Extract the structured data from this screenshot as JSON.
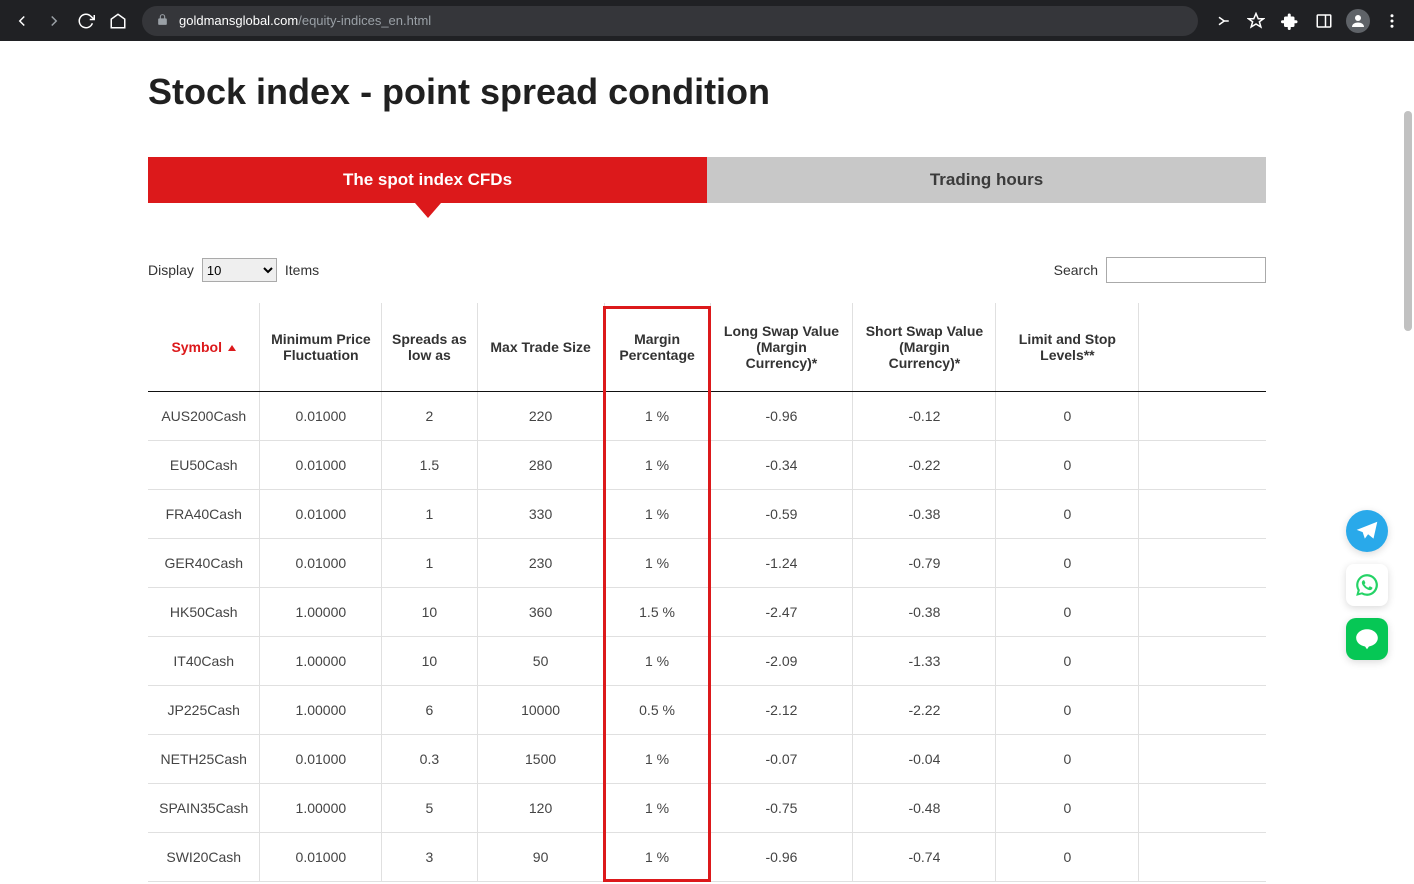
{
  "browser": {
    "url_domain": "goldmansglobal.com",
    "url_path": "/equity-indices_en.html"
  },
  "page": {
    "title": "Stock index - point spread condition"
  },
  "tabs": {
    "active": "The spot index CFDs",
    "inactive": "Trading hours"
  },
  "controls": {
    "display_label": "Display",
    "display_value": "10",
    "items_label": "Items",
    "search_label": "Search",
    "search_value": ""
  },
  "table": {
    "headers": [
      "Symbol",
      "Minimum Price Fluctuation",
      "Spreads as low as",
      "Max Trade Size",
      "Margin Percentage",
      "Long Swap Value (Margin Currency)*",
      "Short Swap Value (Margin Currency)*",
      "Limit and Stop Levels**"
    ],
    "rows": [
      {
        "symbol": "AUS200Cash",
        "min_price": "0.01000",
        "spreads": "2",
        "max_trade": "220",
        "margin": "1 %",
        "long_swap": "-0.96",
        "short_swap": "-0.12",
        "limit_stop": "0"
      },
      {
        "symbol": "EU50Cash",
        "min_price": "0.01000",
        "spreads": "1.5",
        "max_trade": "280",
        "margin": "1 %",
        "long_swap": "-0.34",
        "short_swap": "-0.22",
        "limit_stop": "0"
      },
      {
        "symbol": "FRA40Cash",
        "min_price": "0.01000",
        "spreads": "1",
        "max_trade": "330",
        "margin": "1 %",
        "long_swap": "-0.59",
        "short_swap": "-0.38",
        "limit_stop": "0"
      },
      {
        "symbol": "GER40Cash",
        "min_price": "0.01000",
        "spreads": "1",
        "max_trade": "230",
        "margin": "1 %",
        "long_swap": "-1.24",
        "short_swap": "-0.79",
        "limit_stop": "0"
      },
      {
        "symbol": "HK50Cash",
        "min_price": "1.00000",
        "spreads": "10",
        "max_trade": "360",
        "margin": "1.5 %",
        "long_swap": "-2.47",
        "short_swap": "-0.38",
        "limit_stop": "0"
      },
      {
        "symbol": "IT40Cash",
        "min_price": "1.00000",
        "spreads": "10",
        "max_trade": "50",
        "margin": "1 %",
        "long_swap": "-2.09",
        "short_swap": "-1.33",
        "limit_stop": "0"
      },
      {
        "symbol": "JP225Cash",
        "min_price": "1.00000",
        "spreads": "6",
        "max_trade": "10000",
        "margin": "0.5 %",
        "long_swap": "-2.12",
        "short_swap": "-2.22",
        "limit_stop": "0"
      },
      {
        "symbol": "NETH25Cash",
        "min_price": "0.01000",
        "spreads": "0.3",
        "max_trade": "1500",
        "margin": "1 %",
        "long_swap": "-0.07",
        "short_swap": "-0.04",
        "limit_stop": "0"
      },
      {
        "symbol": "SPAIN35Cash",
        "min_price": "1.00000",
        "spreads": "5",
        "max_trade": "120",
        "margin": "1 %",
        "long_swap": "-0.75",
        "short_swap": "-0.48",
        "limit_stop": "0"
      },
      {
        "symbol": "SWI20Cash",
        "min_price": "0.01000",
        "spreads": "3",
        "max_trade": "90",
        "margin": "1 %",
        "long_swap": "-0.96",
        "short_swap": "-0.74",
        "limit_stop": "0"
      }
    ]
  },
  "chart_data": {
    "type": "table",
    "title": "Stock index - point spread condition — The spot index CFDs",
    "columns": [
      "Symbol",
      "Minimum Price Fluctuation",
      "Spreads as low as",
      "Max Trade Size",
      "Margin Percentage",
      "Long Swap Value (Margin Currency)*",
      "Short Swap Value (Margin Currency)*",
      "Limit and Stop Levels**"
    ],
    "rows": [
      [
        "AUS200Cash",
        0.01,
        2,
        220,
        "1 %",
        -0.96,
        -0.12,
        0
      ],
      [
        "EU50Cash",
        0.01,
        1.5,
        280,
        "1 %",
        -0.34,
        -0.22,
        0
      ],
      [
        "FRA40Cash",
        0.01,
        1,
        330,
        "1 %",
        -0.59,
        -0.38,
        0
      ],
      [
        "GER40Cash",
        0.01,
        1,
        230,
        "1 %",
        -1.24,
        -0.79,
        0
      ],
      [
        "HK50Cash",
        1.0,
        10,
        360,
        "1.5 %",
        -2.47,
        -0.38,
        0
      ],
      [
        "IT40Cash",
        1.0,
        10,
        50,
        "1 %",
        -2.09,
        -1.33,
        0
      ],
      [
        "JP225Cash",
        1.0,
        6,
        10000,
        "0.5 %",
        -2.12,
        -2.22,
        0
      ],
      [
        "NETH25Cash",
        0.01,
        0.3,
        1500,
        "1 %",
        -0.07,
        -0.04,
        0
      ],
      [
        "SPAIN35Cash",
        1.0,
        5,
        120,
        "1 %",
        -0.75,
        -0.48,
        0
      ],
      [
        "SWI20Cash",
        0.01,
        3,
        90,
        "1 %",
        -0.96,
        -0.74,
        0
      ]
    ]
  }
}
